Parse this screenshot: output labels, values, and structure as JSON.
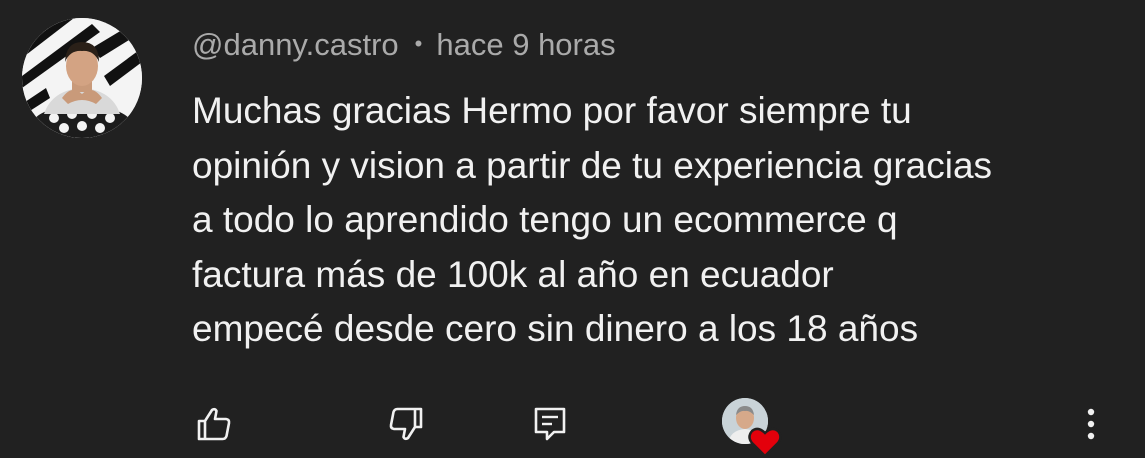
{
  "comment": {
    "author": "@danny.castro",
    "separator": "•",
    "timestamp": "hace 9 horas",
    "text_lines": [
      "Muchas gracias Hermo por favor siempre tu",
      "opinión y vision a partir de tu experiencia gracias",
      "a todo lo aprendido tengo un ecommerce q",
      "factura más de 100k al año en ecuador",
      "empecé desde cero sin dinero a los 18 años"
    ]
  },
  "actions": {
    "like_icon": "thumbs-up-icon",
    "dislike_icon": "thumbs-down-icon",
    "reply_icon": "reply-comment-icon",
    "more_icon": "more-vertical-icon",
    "creator_heart_icon": "heart-icon"
  },
  "colors": {
    "background": "#212121",
    "primary_text": "#f1f1f1",
    "secondary_text": "#aaaaaa",
    "heart": "#e3000b"
  }
}
